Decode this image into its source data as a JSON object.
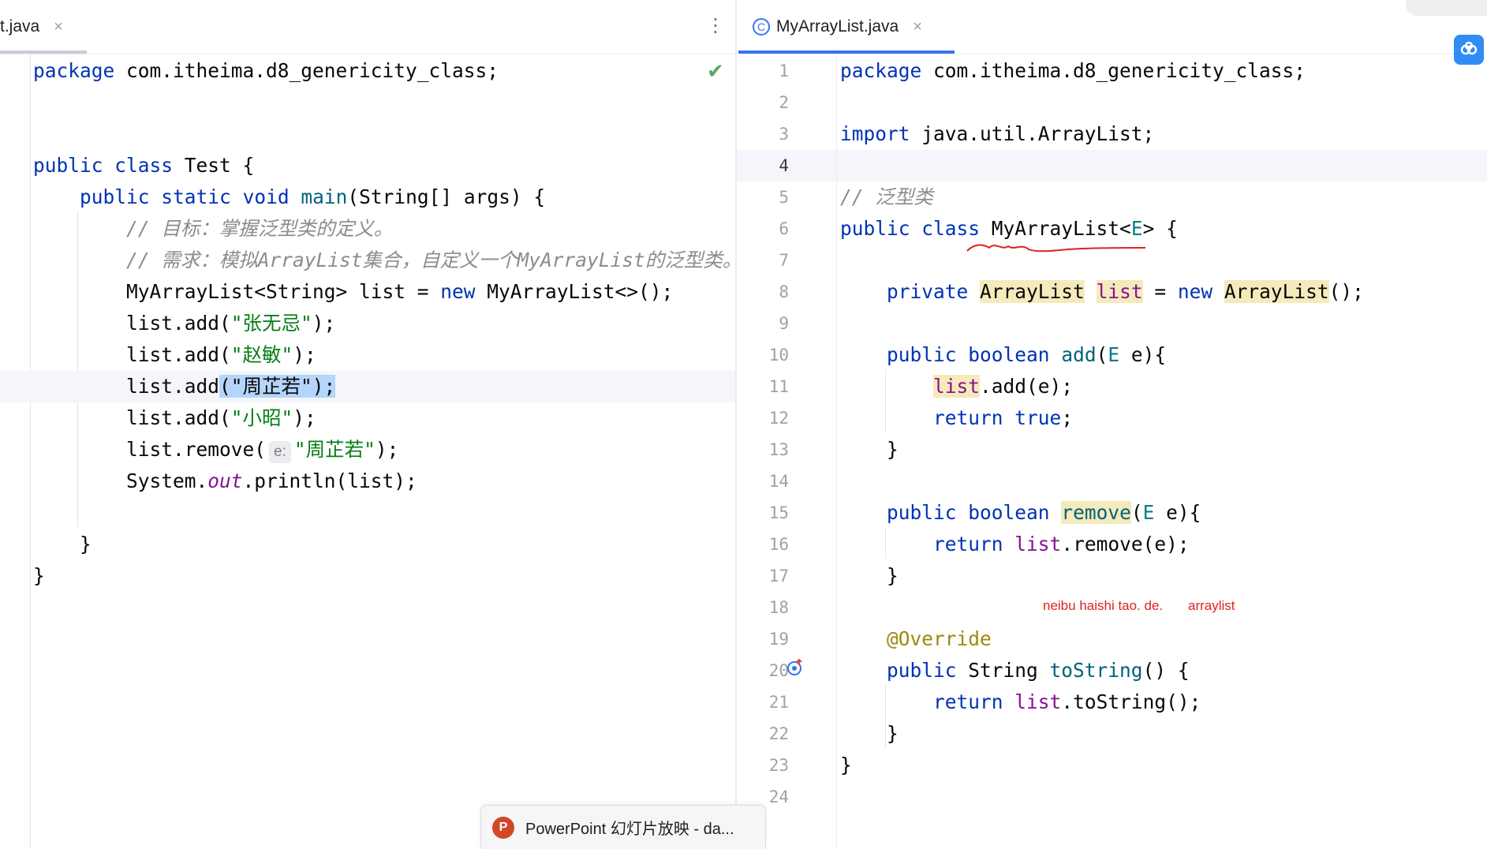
{
  "left_editor": {
    "tab_label": "t.java",
    "tab_close": "×",
    "lines": {
      "l1": {
        "a": "package",
        "b": " com.itheima.d8_genericity_class;"
      },
      "l4": {
        "a": "public",
        "b": " ",
        "c": "class",
        "d": " Test {"
      },
      "l5": {
        "a": "    ",
        "b": "public",
        "c": " ",
        "d": "static",
        "e": " ",
        "f": "void",
        "g": " ",
        "h": "main",
        "i": "(String[] args) {"
      },
      "l6": "        // 目标：掌握泛型类的定义。",
      "l7": "        // 需求：模拟ArrayList集合，自定义一个MyArrayList的泛型类。",
      "l8": {
        "a": "        MyArrayList<String> list = ",
        "b": "new",
        "c": " MyArrayList<>();"
      },
      "l9": {
        "a": "        list.add(",
        "b": "\"张无忌\"",
        "c": ");"
      },
      "l10": {
        "a": "        list.add(",
        "b": "\"赵敏\"",
        "c": ");"
      },
      "l11": {
        "a": "        list.add",
        "b": "(\"周芷若\");"
      },
      "l12": {
        "a": "        list.add(",
        "b": "\"小昭\"",
        "c": ");"
      },
      "l13": {
        "a": "        list.remove(",
        "hint": "e:",
        "b": "\"周芷若\"",
        "c": ");"
      },
      "l14": {
        "a": "        System.",
        "b": "out",
        "c": ".println(list);"
      },
      "l16": "    }",
      "l17": "}"
    }
  },
  "right_editor": {
    "tab_label": "MyArrayList.java",
    "tab_close": "×",
    "tab_icon": "class-icon",
    "line_numbers": [
      "1",
      "2",
      "3",
      "4",
      "5",
      "6",
      "7",
      "8",
      "9",
      "10",
      "11",
      "12",
      "13",
      "14",
      "15",
      "16",
      "17",
      "18",
      "19",
      "20",
      "21",
      "22",
      "23",
      "24"
    ],
    "current_line": "4",
    "lines": {
      "r1": {
        "a": "package",
        "b": " com.itheima.d8_genericity_class;"
      },
      "r3": {
        "a": "import",
        "b": " java.util.ArrayList;"
      },
      "r5": "// 泛型类",
      "r6": {
        "a": "public",
        "b": " ",
        "c": "class",
        "d": " MyArrayList<",
        "e": "E",
        "f": "> {"
      },
      "r8": {
        "a": "private",
        "b": " ",
        "c": "ArrayList",
        "d": " ",
        "e": "list",
        "f": " = ",
        "g": "new",
        "h": " ",
        "i": "ArrayList",
        "j": "();"
      },
      "r10": {
        "a": "public",
        "b": " ",
        "c": "boolean",
        "d": " ",
        "e": "add",
        "f": "(",
        "g": "E",
        "h": " e){"
      },
      "r11": {
        "a": "list",
        "b": ".add(e);"
      },
      "r12": {
        "a": "return",
        "b": " ",
        "c": "true",
        "d": ";"
      },
      "r13": "}",
      "r15": {
        "a": "public",
        "b": " ",
        "c": "boolean",
        "d": " ",
        "e": "remove",
        "f": "(",
        "g": "E",
        "h": " e){"
      },
      "r16": {
        "a": "return",
        "b": " ",
        "c": "list",
        "d": ".remove(e);"
      },
      "r17": "}",
      "r19": "@Override",
      "r20": {
        "a": "public",
        "b": " String ",
        "c": "toString",
        "d": "() {"
      },
      "r21": {
        "a": "return",
        "b": " ",
        "c": "list",
        "d": ".toString();"
      },
      "r22": "}",
      "r23": "}"
    },
    "annotation_note_1": "neibu haishi tao. de.",
    "annotation_note_2": "arraylist"
  },
  "taskbar": {
    "label": "PowerPoint 幻灯片放映  -  da...",
    "icon_letter": "P"
  },
  "colors": {
    "keyword": "#0033b3",
    "string": "#067d17",
    "comment": "#8c8c8c",
    "field": "#871094",
    "annotation": "#9e880d",
    "accent": "#3574f0",
    "note_red": "#e02020"
  }
}
